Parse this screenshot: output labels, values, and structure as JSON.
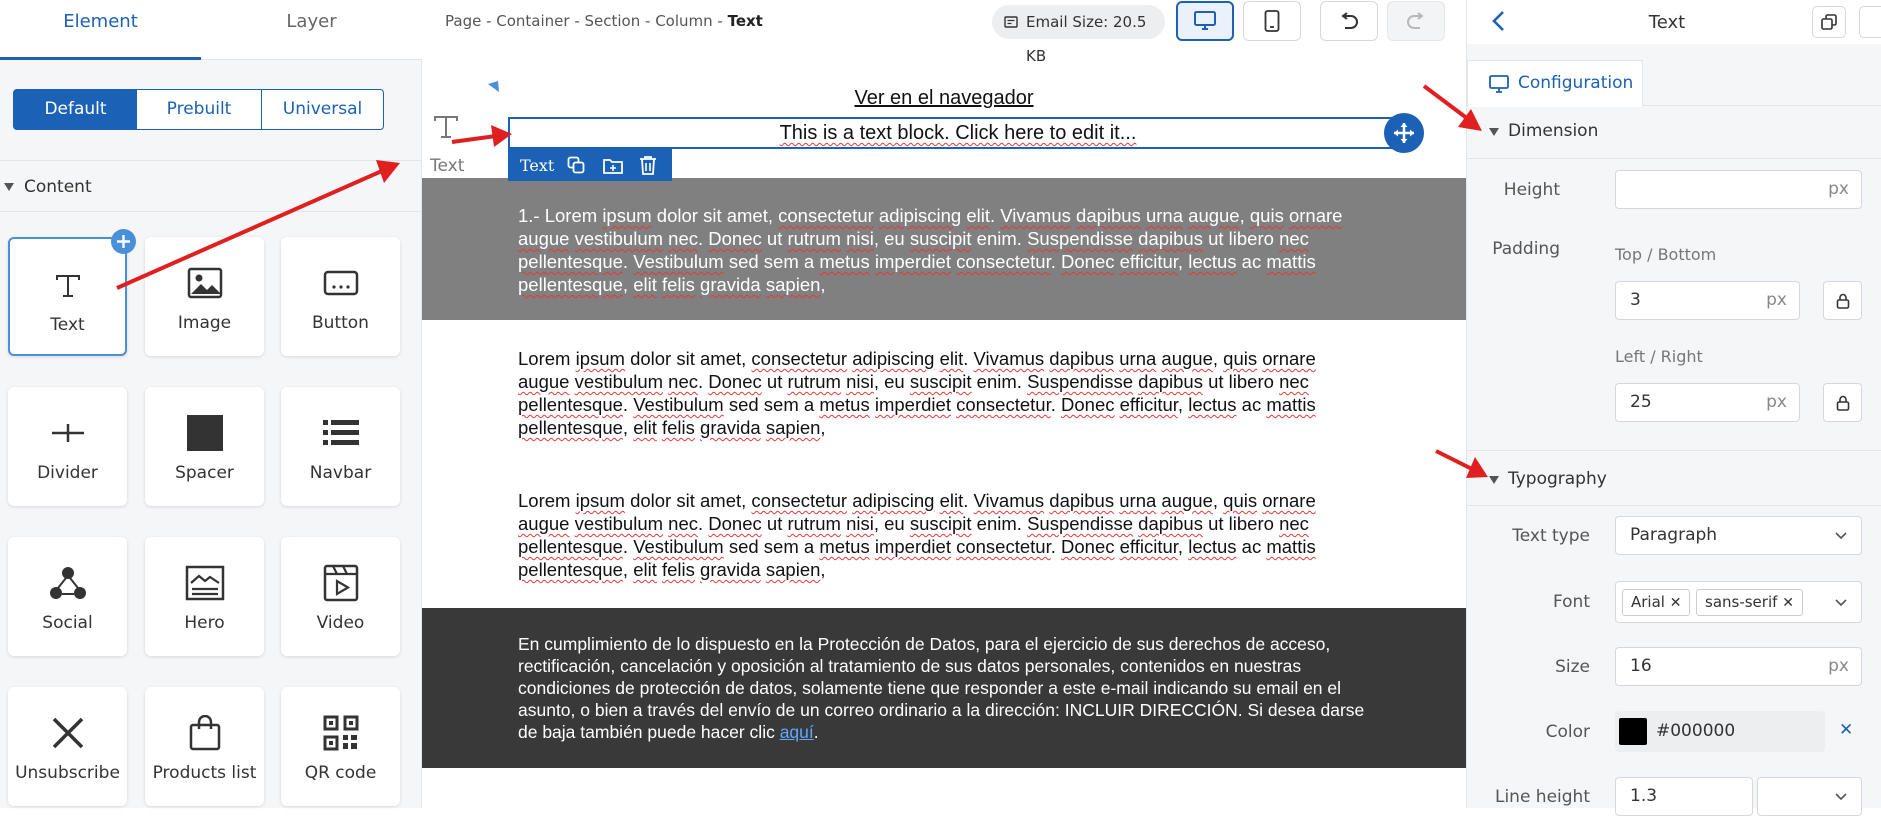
{
  "left_panel": {
    "tabs": [
      "Element",
      "Layer"
    ],
    "segments": [
      "Default",
      "Prebuilt",
      "Universal"
    ],
    "section_title": "Content",
    "elements": [
      {
        "label": "Text",
        "icon": "text-icon"
      },
      {
        "label": "Image",
        "icon": "image-icon"
      },
      {
        "label": "Button",
        "icon": "button-icon"
      },
      {
        "label": "Divider",
        "icon": "divider-icon"
      },
      {
        "label": "Spacer",
        "icon": "spacer-icon"
      },
      {
        "label": "Navbar",
        "icon": "navbar-icon"
      },
      {
        "label": "Social",
        "icon": "social-icon"
      },
      {
        "label": "Hero",
        "icon": "hero-icon"
      },
      {
        "label": "Video",
        "icon": "video-icon"
      },
      {
        "label": "Unsubscribe",
        "icon": "unsubscribe-icon"
      },
      {
        "label": "Products list",
        "icon": "products-list-icon"
      },
      {
        "label": "QR code",
        "icon": "qr-code-icon"
      }
    ]
  },
  "toolbar": {
    "breadcrumb": "Page - Container - Section - Column - ",
    "breadcrumb_current": "Text",
    "email_size": "Email Size: 20.5 KB"
  },
  "canvas": {
    "drag_label": "Text",
    "browser_link": "Ver en el navegador",
    "text_block": "This is a text block. Click here to edit it...",
    "selection_label": "Text",
    "paragraph_1_prefix": "1.- ",
    "paragraph_lorem": "Lorem ipsum dolor sit amet, consectetur adipiscing elit. Vivamus dapibus urna augue, quis ornare augue vestibulum nec. Donec ut rutrum nisi, eu suscipit enim. Suspendisse dapibus ut libero nec pellentesque. Vestibulum sed sem a metus imperdiet consectetur. Donec efficitur, lectus ac mattis pellentesque, elit felis gravida sapien,",
    "footer_text": "En cumplimiento de lo dispuesto en la Protección de Datos, para el ejercicio de sus derechos de acceso, rectificación, cancelación y oposición al tratamiento de sus datos personales, contenidos en nuestras condiciones de protección de datos, solamente tiene que responder a este e-mail indicando su email en el asunto, o bien a través del envío de un correo ordinario a la dirección: INCLUIR DIRECCIÓN. Si desea darse de baja también puede hacer clic ",
    "footer_link": "aquí",
    "footer_end": "."
  },
  "right_panel": {
    "title": "Text",
    "config_tab": "Configuration",
    "dimension": {
      "title": "Dimension",
      "height_label": "Height",
      "height_value": "",
      "padding_label": "Padding",
      "top_bottom_label": "Top / Bottom",
      "top_bottom_value": "3",
      "left_right_label": "Left / Right",
      "left_right_value": "25",
      "unit": "px"
    },
    "typography": {
      "title": "Typography",
      "text_type_label": "Text type",
      "text_type_value": "Paragraph",
      "font_label": "Font",
      "font_tags": [
        "Arial",
        "sans-serif"
      ],
      "size_label": "Size",
      "size_value": "16",
      "color_label": "Color",
      "color_value": "#000000",
      "line_height_label": "Line height",
      "line_height_value": "1.3"
    }
  },
  "colors": {
    "accent": "#1b61b5",
    "gray_band": "#808080",
    "dark_band": "#393939",
    "annotation_arrow": "#e02020"
  }
}
